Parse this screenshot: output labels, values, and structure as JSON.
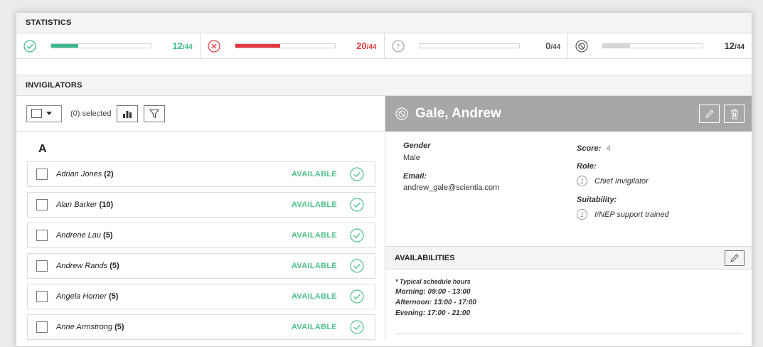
{
  "statistics": {
    "title": "STATISTICS",
    "items": [
      {
        "icon": "check-circle-icon",
        "value": 12,
        "total": 44,
        "value_text": "12",
        "total_text": "/44",
        "color": "#3cb98a",
        "fill": 0.2727
      },
      {
        "icon": "x-circle-icon",
        "value": 20,
        "total": 44,
        "value_text": "20",
        "total_text": "/44",
        "color": "#e3393f",
        "fill": 0.4545
      },
      {
        "icon": "question-circle-icon",
        "value": 0,
        "total": 44,
        "value_text": "0",
        "total_text": "/44",
        "color": "#888888",
        "fill": 0.0
      },
      {
        "icon": "unavailable-circle-icon",
        "value": 12,
        "total": 44,
        "value_text": "12",
        "total_text": "/44",
        "color": "#d6d6d6",
        "fill": 0.2727
      }
    ]
  },
  "invigilators": {
    "title": "INVIGILATORS",
    "selected_label": "(0) selected",
    "group_letter": "A",
    "rows": [
      {
        "name": "Adrian Jones",
        "count": " (2)",
        "status": "AVAILABLE"
      },
      {
        "name": "Alan Barker",
        "count": " (10)",
        "status": "AVAILABLE"
      },
      {
        "name": "Andrene Lau",
        "count": " (5)",
        "status": "AVAILABLE"
      },
      {
        "name": "Andrew Rands",
        "count": " (5)",
        "status": "AVAILABLE"
      },
      {
        "name": "Angela Horner",
        "count": " (5)",
        "status": "AVAILABLE"
      },
      {
        "name": "Anne Armstrong",
        "count": " (5)",
        "status": "AVAILABLE"
      }
    ]
  },
  "detail": {
    "name": "Gale, Andrew",
    "gender_label": "Gender",
    "gender_value": "Male",
    "email_label": "Email:",
    "email_value": "andrew_gale@scientia.com",
    "score_label": "Score:",
    "score_value": "4",
    "role_label": "Role:",
    "role_num": "1",
    "role_value": "Chief Invigilator",
    "suitability_label": "Suitability:",
    "suitability_num": "1",
    "suitability_value": "I/NEP support trained"
  },
  "availabilities": {
    "title": "AVAILABILITIES",
    "note": "* Typical schedule hours",
    "morning": "Morning: 09:00 - 13:00",
    "afternoon": "Afternoon: 13:00 - 17:00",
    "evening": "Evening: 17:00 - 21:00"
  },
  "colors": {
    "available": "#4cbf8a",
    "header_bg": "#a7a7a7"
  }
}
